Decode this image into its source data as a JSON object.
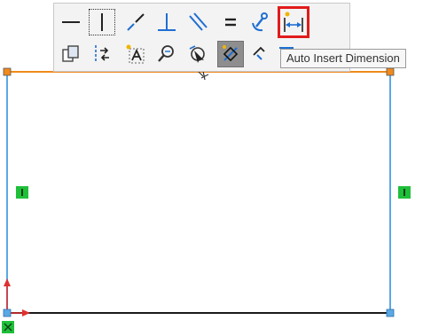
{
  "toolbar": {
    "row1": [
      {
        "name": "horizontal-relation-button",
        "icon": "horizontal-line-icon"
      },
      {
        "name": "vertical-relation-button",
        "icon": "vertical-line-icon"
      },
      {
        "name": "collinear-relation-button",
        "icon": "diagonal-dashed-line-icon"
      },
      {
        "name": "perpendicular-relation-button",
        "icon": "perpendicular-icon"
      },
      {
        "name": "parallel-relation-button",
        "icon": "parallel-icon"
      },
      {
        "name": "equal-relation-button",
        "icon": "equal-icon"
      },
      {
        "name": "fix-relation-button",
        "icon": "anchor-icon"
      },
      {
        "name": "auto-insert-dimension-button",
        "icon": "auto-dimension-icon"
      }
    ],
    "row2": [
      {
        "name": "copy-entities-button",
        "icon": "copy-entities-icon"
      },
      {
        "name": "construction-geometry-button",
        "icon": "construction-geometry-icon"
      },
      {
        "name": "sketch-text-button",
        "icon": "sketch-text-icon"
      },
      {
        "name": "zoom-to-selection-button",
        "icon": "zoom-magnifier-icon"
      },
      {
        "name": "select-chain-button",
        "icon": "select-chain-icon"
      },
      {
        "name": "smart-dimension-button",
        "icon": "smart-dimension-icon"
      },
      {
        "name": "convert-entities-button",
        "icon": "convert-entities-icon"
      },
      {
        "name": "offset-entities-button",
        "icon": "offset-entities-icon"
      }
    ]
  },
  "tooltip": {
    "text": "Auto Insert Dimension"
  },
  "sketch": {
    "colors": {
      "top_edge": "#f08a1c",
      "side_edges": "#5aa9e6",
      "bottom_edge": "#1a1a1a",
      "relation_badge": "#1fbf3a",
      "origin_arrow": "#e03030",
      "endpoint_orange": "#f08a1c",
      "endpoint_blue": "#5aa9e6"
    }
  }
}
